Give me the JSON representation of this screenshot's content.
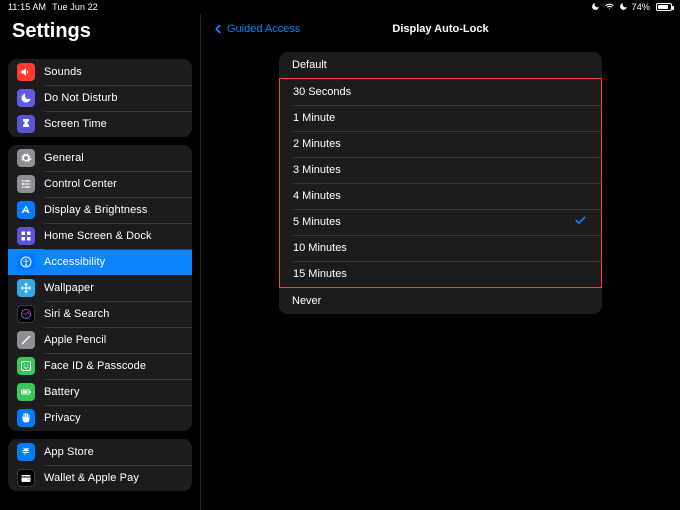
{
  "status_bar": {
    "time": "11:15 AM",
    "date": "Tue Jun 22",
    "battery_text": "74%"
  },
  "sidebar": {
    "title": "Settings",
    "groups": [
      {
        "rows": [
          {
            "id": "sounds",
            "label": "Sounds"
          },
          {
            "id": "dnd",
            "label": "Do Not Disturb"
          },
          {
            "id": "screentime",
            "label": "Screen Time"
          }
        ]
      },
      {
        "rows": [
          {
            "id": "general",
            "label": "General"
          },
          {
            "id": "controlcenter",
            "label": "Control Center"
          },
          {
            "id": "display",
            "label": "Display & Brightness"
          },
          {
            "id": "homescreen",
            "label": "Home Screen & Dock"
          },
          {
            "id": "accessibility",
            "label": "Accessibility",
            "active": true
          },
          {
            "id": "wallpaper",
            "label": "Wallpaper"
          },
          {
            "id": "siri",
            "label": "Siri & Search"
          },
          {
            "id": "applepencil",
            "label": "Apple Pencil"
          },
          {
            "id": "faceid",
            "label": "Face ID & Passcode"
          },
          {
            "id": "battery",
            "label": "Battery"
          },
          {
            "id": "privacy",
            "label": "Privacy"
          }
        ]
      },
      {
        "rows": [
          {
            "id": "appstore",
            "label": "App Store"
          },
          {
            "id": "wallet",
            "label": "Wallet & Apple Pay"
          }
        ]
      }
    ]
  },
  "detail": {
    "back_label": "Guided Access",
    "title": "Display Auto-Lock",
    "default_label": "Default",
    "never_label": "Never",
    "options": [
      {
        "label": "30 Seconds"
      },
      {
        "label": "1 Minute"
      },
      {
        "label": "2 Minutes"
      },
      {
        "label": "3 Minutes"
      },
      {
        "label": "4 Minutes"
      },
      {
        "label": "5 Minutes",
        "selected": true
      },
      {
        "label": "10 Minutes"
      },
      {
        "label": "15 Minutes"
      }
    ]
  },
  "icons": {
    "sounds": {
      "bg": "bg-red",
      "glyph": "speaker"
    },
    "dnd": {
      "bg": "bg-purple",
      "glyph": "moon"
    },
    "screentime": {
      "bg": "bg-indigo",
      "glyph": "hourglass"
    },
    "general": {
      "bg": "bg-gray",
      "glyph": "gear"
    },
    "controlcenter": {
      "bg": "bg-gray",
      "glyph": "switches"
    },
    "display": {
      "bg": "bg-blue",
      "glyph": "textsize"
    },
    "homescreen": {
      "bg": "bg-indigo",
      "glyph": "grid"
    },
    "accessibility": {
      "bg": "bg-blue",
      "glyph": "accessibility"
    },
    "wallpaper": {
      "bg": "bg-teal",
      "glyph": "flower"
    },
    "siri": {
      "bg": "bg-black",
      "glyph": "siri"
    },
    "applepencil": {
      "bg": "bg-gray",
      "glyph": "pencil"
    },
    "faceid": {
      "bg": "bg-green",
      "glyph": "faceid"
    },
    "battery": {
      "bg": "bg-green",
      "glyph": "battery"
    },
    "privacy": {
      "bg": "bg-blue",
      "glyph": "hand"
    },
    "appstore": {
      "bg": "bg-blue",
      "glyph": "appstore"
    },
    "wallet": {
      "bg": "bg-black",
      "glyph": "wallet"
    }
  }
}
